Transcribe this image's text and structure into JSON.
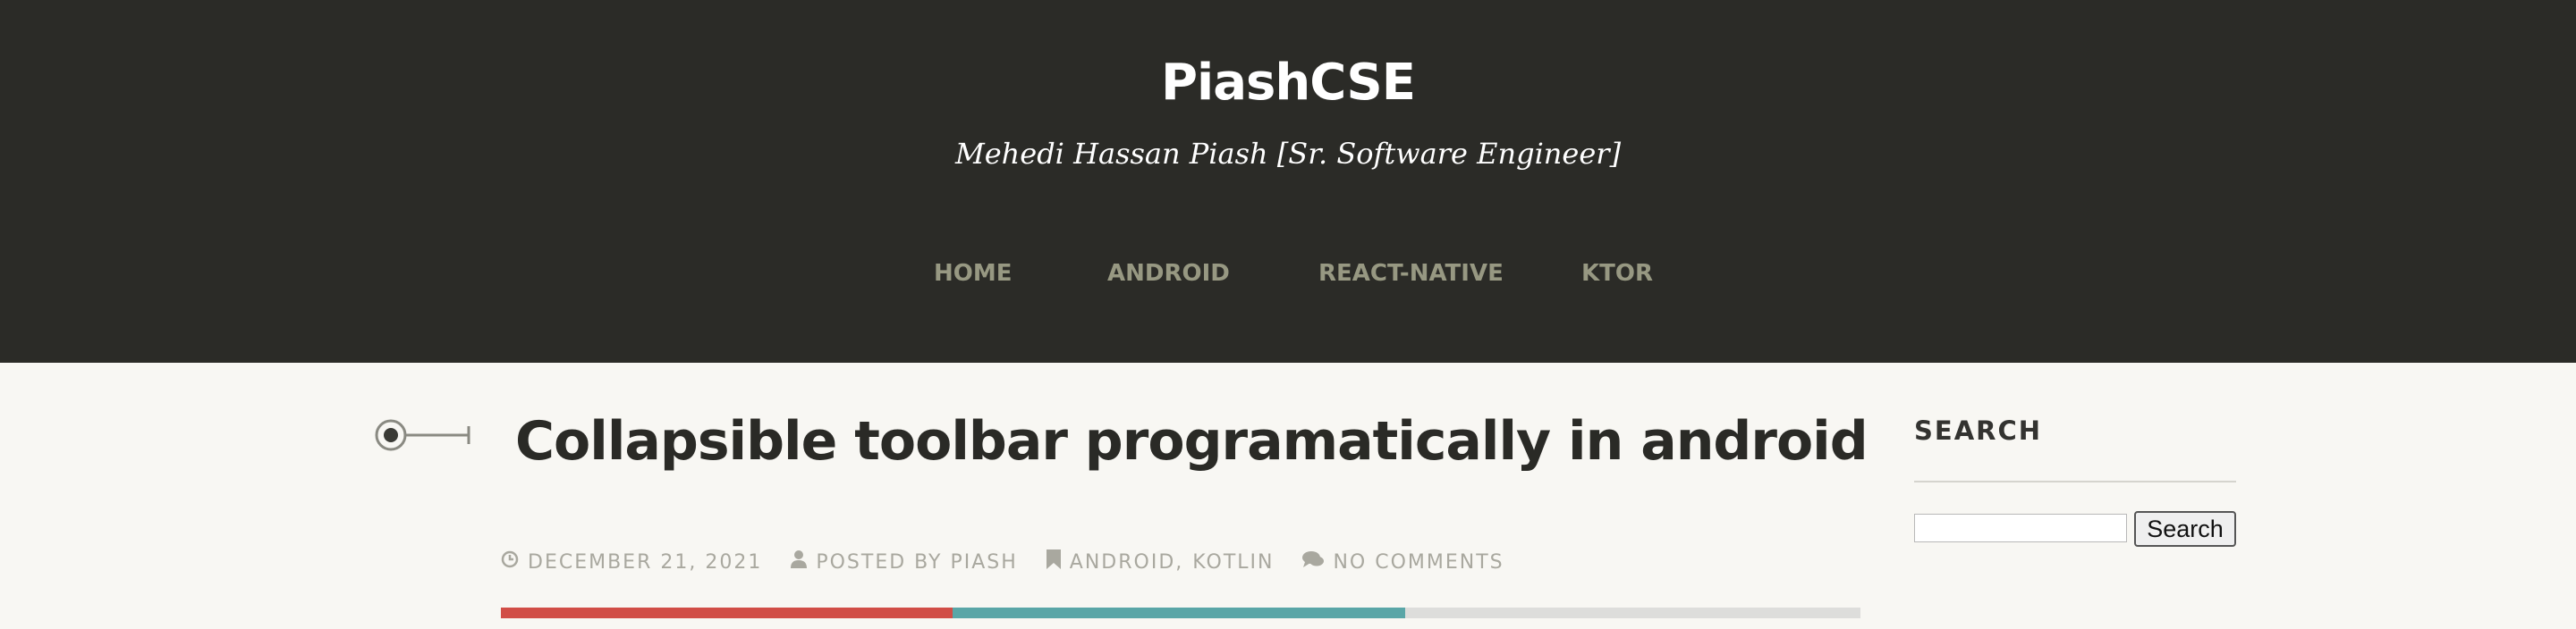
{
  "header": {
    "site_title": "PiashCSE",
    "tagline": "Mehedi Hassan Piash [Sr. Software Engineer]"
  },
  "nav": {
    "items": [
      {
        "label": "HOME"
      },
      {
        "label": "ANDROID"
      },
      {
        "label": "REACT-NATIVE"
      },
      {
        "label": "KTOR"
      }
    ]
  },
  "post": {
    "title": "Collapsible toolbar programatically in android",
    "meta": {
      "date": "DECEMBER 21, 2021",
      "posted_by": "POSTED BY PIASH",
      "category_1": "ANDROID",
      "separator": ",",
      "category_2": "KOTLIN",
      "comments": "NO COMMENTS"
    },
    "icons": {
      "date": "clock-icon",
      "author": "user-icon",
      "category": "bookmark-icon",
      "comments": "comments-icon",
      "post_format": "standard-post-icon"
    },
    "color_bar": [
      "#d14d46",
      "#5aa6a7",
      "#dddddb"
    ]
  },
  "sidebar": {
    "search_title": "SEARCH",
    "search_placeholder": "",
    "search_button": "Search"
  }
}
